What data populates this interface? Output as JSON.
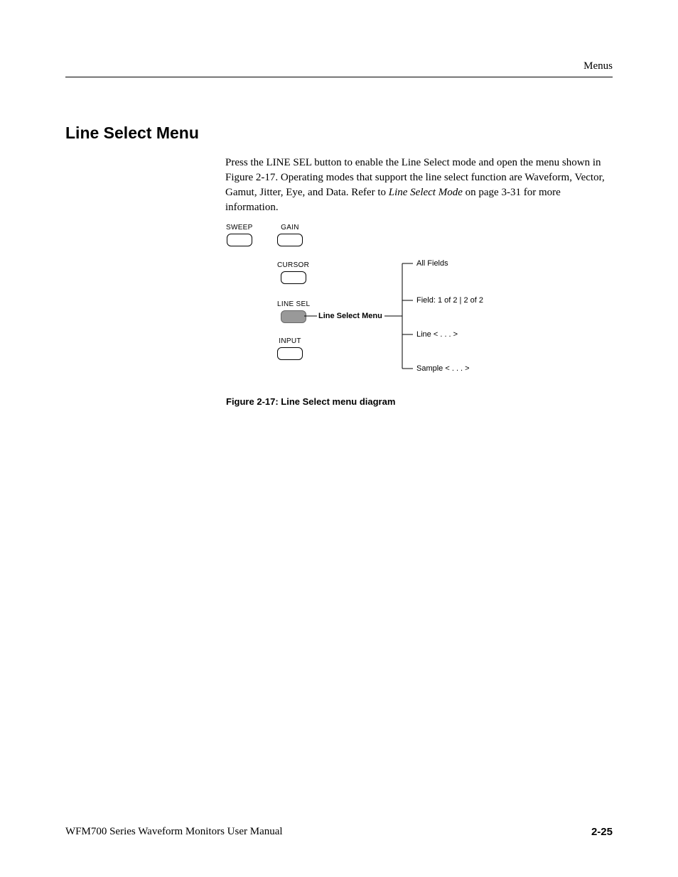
{
  "header": {
    "label": "Menus"
  },
  "section": {
    "title": "Line Select Menu"
  },
  "body": {
    "text1": "Press the LINE SEL button to enable the Line Select mode and open the menu shown in Figure 2-17. Operating modes that support the line select function are Waveform, Vector, Gamut, Jitter, Eye, and Data. Refer to ",
    "text1_italic": "Line Select Mode",
    "text1_end": " on page 3-31 for more information."
  },
  "diagram": {
    "buttons": {
      "sweep": "SWEEP",
      "gain": "GAIN",
      "cursor": "CURSOR",
      "linesel": "LINE SEL",
      "input": "INPUT"
    },
    "menu_title": "Line Select Menu",
    "menu_items": {
      "all_fields": "All Fields",
      "field": "Field: 1 of 2 | 2 of 2",
      "line": "Line < . . . >",
      "sample": "Sample < . . . >"
    }
  },
  "figure_caption": "Figure 2-17: Line Select menu diagram",
  "footer": {
    "left": "WFM700 Series Waveform Monitors User Manual",
    "right": "2-25"
  }
}
